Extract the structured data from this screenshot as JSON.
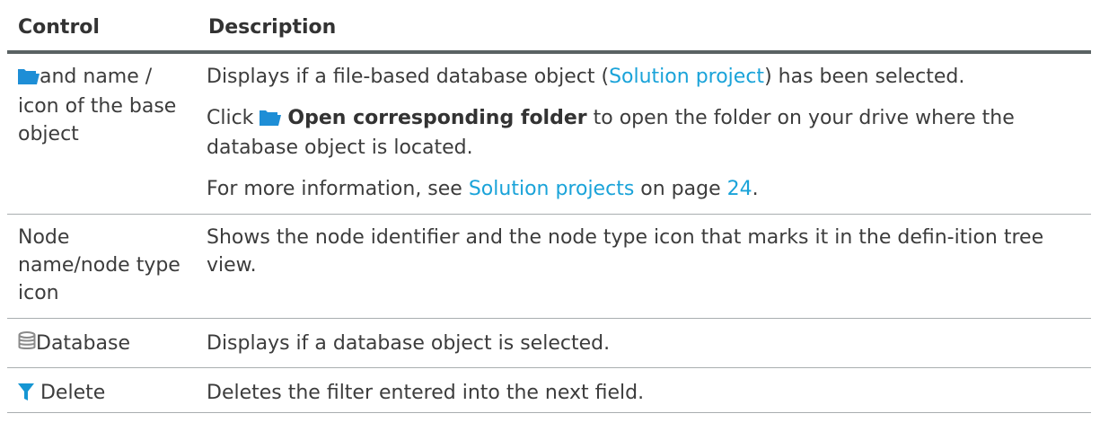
{
  "table": {
    "headers": {
      "control": "Control",
      "description": "Description"
    },
    "rows": [
      {
        "control_icon": "folder-icon",
        "control_text": "and name / icon of the base object",
        "desc1_pre": "Displays if a file-based database object (",
        "desc1_link": "Solution project",
        "desc1_post": ") has been selected.",
        "desc2_pre": "Click ",
        "desc2_icon": "folder-icon",
        "desc2_bold": "Open corresponding folder",
        "desc2_post": " to open the folder on your drive where the database object is located.",
        "desc3_pre": "For more information, see ",
        "desc3_link": "Solution projects",
        "desc3_mid": " on page ",
        "desc3_page": "24",
        "desc3_post": "."
      },
      {
        "control_text": "Node name/node type icon",
        "desc": "Shows the node identifier and the node type icon that marks it in the defin-ition tree view."
      },
      {
        "control_icon": "database-icon",
        "control_text": "Database",
        "desc": "Displays if a database object is selected."
      },
      {
        "control_icon": "filter-icon",
        "control_text": " Delete",
        "desc": "Deletes the filter entered into the next field."
      }
    ]
  },
  "colors": {
    "link": "#1aa3d9",
    "folder_icon": "#1e8ed6",
    "filter_icon": "#1596d3",
    "database_icon": "#8a8a8a"
  }
}
